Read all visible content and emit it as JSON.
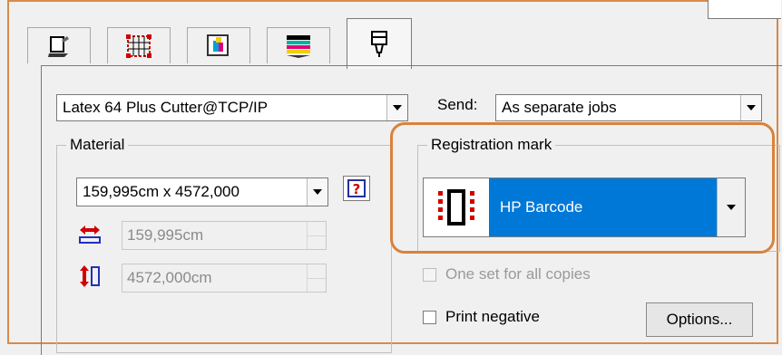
{
  "tabs": [
    {
      "icon": "pen-plotter-icon"
    },
    {
      "icon": "grid-selection-icon"
    },
    {
      "icon": "image-colors-icon"
    },
    {
      "icon": "color-layers-icon"
    },
    {
      "icon": "cutter-tool-icon"
    }
  ],
  "printer": {
    "selected": "Latex 64 Plus Cutter@TCP/IP"
  },
  "send": {
    "label": "Send:",
    "selected": "As separate jobs"
  },
  "material": {
    "label": "Material",
    "size_selected": "159,995cm x 4572,000",
    "width_value": "159,995cm",
    "length_value": "4572,000cm"
  },
  "registration": {
    "label": "Registration mark",
    "selected": "HP Barcode",
    "one_set_label": "One set for all copies",
    "print_negative_label": "Print negative",
    "options_label": "Options..."
  },
  "colors": {
    "frame": "#d88a4a",
    "highlight": "#d9823b",
    "selection": "#0078d7"
  }
}
